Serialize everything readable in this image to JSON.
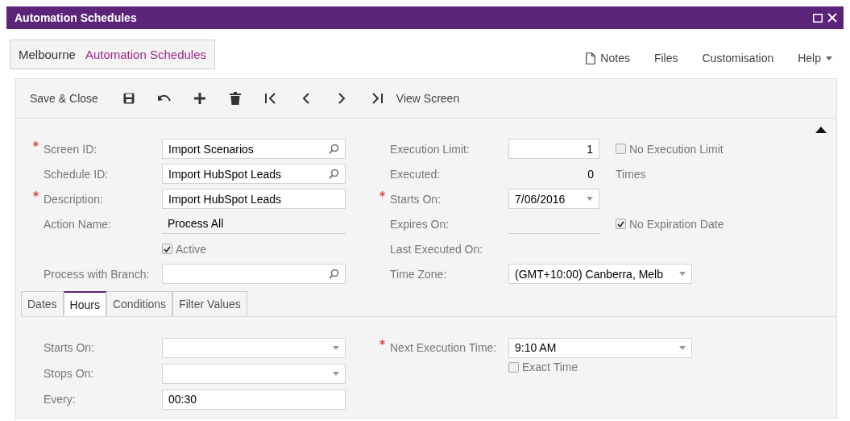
{
  "window": {
    "title": "Automation Schedules"
  },
  "breadcrumb": {
    "branch": "Melbourne",
    "screen": "Automation Schedules"
  },
  "header_links": [
    {
      "label": "Notes",
      "kind": "notes"
    },
    {
      "label": "Files",
      "kind": "plain"
    },
    {
      "label": "Customisation",
      "kind": "plain"
    },
    {
      "label": "Help",
      "kind": "menu"
    }
  ],
  "toolbar": [
    {
      "kind": "text",
      "label": "Save & Close"
    },
    {
      "kind": "save"
    },
    {
      "kind": "undo"
    },
    {
      "kind": "add"
    },
    {
      "kind": "delete"
    },
    {
      "kind": "first"
    },
    {
      "kind": "prev"
    },
    {
      "kind": "next"
    },
    {
      "kind": "last"
    },
    {
      "kind": "text",
      "label": "View Screen"
    }
  ],
  "form": {
    "left": [
      {
        "label": "Screen ID:",
        "required": true,
        "kind": "lookup",
        "value": "Import Scenarios"
      },
      {
        "label": "Schedule ID:",
        "required": false,
        "kind": "lookup",
        "value": "Import HubSpot Leads"
      },
      {
        "label": "Description:",
        "required": true,
        "kind": "text",
        "value": "Import HubSpot Leads"
      },
      {
        "label": "Action Name:",
        "required": false,
        "kind": "display",
        "value": "Process All"
      },
      {
        "kind": "checkbox",
        "label": "Active",
        "checked": true
      },
      {
        "label": "Process with Branch:",
        "required": false,
        "kind": "lookup"
      }
    ],
    "right": [
      {
        "label": "Execution Limit:",
        "required": false,
        "kind": "number",
        "value": "1",
        "extra": {
          "kind": "checkbox",
          "label": "No Execution Limit",
          "checked": false
        }
      },
      {
        "label": "Executed:",
        "required": false,
        "kind": "readonly",
        "value": "0",
        "extra": {
          "kind": "text",
          "label": "Times"
        }
      },
      {
        "label": "Starts On:",
        "required": true,
        "kind": "dropdown",
        "value": "7/06/2016"
      },
      {
        "label": "Expires On:",
        "required": false,
        "kind": "display",
        "extra": {
          "kind": "checkbox",
          "label": "No Expiration Date",
          "checked": true
        }
      },
      {
        "label": "Last Executed On:",
        "required": false,
        "kind": "empty"
      },
      {
        "label": "Time Zone:",
        "required": false,
        "kind": "wide-dropdown",
        "value": "(GMT+10:00) Canberra, Melb"
      }
    ]
  },
  "tabs": [
    {
      "label": "Dates",
      "selected": false
    },
    {
      "label": "Hours",
      "selected": true
    },
    {
      "label": "Conditions",
      "selected": false
    },
    {
      "label": "Filter Values",
      "selected": false
    }
  ],
  "hours": {
    "left": [
      {
        "label": "Starts On:",
        "required": false,
        "kind": "dropdown"
      },
      {
        "label": "Stops On:",
        "required": false,
        "kind": "dropdown"
      },
      {
        "label": "Every:",
        "required": false,
        "kind": "text",
        "value": "00:30"
      }
    ],
    "right": [
      {
        "label": "Next Execution Time:",
        "required": true,
        "kind": "dropdown",
        "value": "9:10 AM"
      },
      {
        "kind": "checkbox",
        "label": "Exact Time",
        "checked": false
      }
    ]
  }
}
